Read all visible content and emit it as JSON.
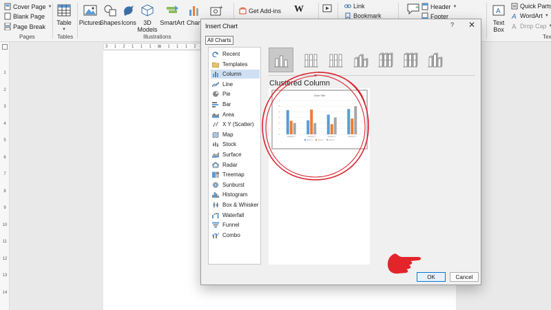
{
  "ribbon": {
    "pages_group": {
      "cover_page": "Cover Page",
      "blank_page": "Blank Page",
      "page_break": "Page Break",
      "label": "Pages"
    },
    "tables_group": {
      "table": "Table",
      "label": "Tables"
    },
    "illustrations_group": {
      "pictures": "Pictures",
      "shapes": "Shapes",
      "icons": "Icons",
      "models_3d": "3D",
      "models_3d_2": "Models",
      "smartart": "SmartArt",
      "chart": "Chart",
      "label": "Illustrations"
    },
    "addins_group": {
      "get_addins": "Get Add-ins",
      "wikipedia_glyph": "W"
    },
    "links_group": {
      "link": "Link",
      "bookmark": "Bookmark"
    },
    "header_footer_group": {
      "header": "Header",
      "footer": "Footer"
    },
    "text_group": {
      "text_box": "Text",
      "text_box_2": "Box",
      "quick_parts": "Quick Parts",
      "wordart": "WordArt",
      "drop_cap": "Drop Cap",
      "label_partial": "Tex"
    }
  },
  "ruler": {
    "horizontal_text": "3 · 1 · 2 · 1 · 1 · 1 · ⊠ · 1 · 1 · 1 · 2 · 1 · 3 · 1 · 4 · 1 · 5 · 1 · 6 · 1 · 7 · 1 · 8 · 1 · 9 · 1 · 10 · 1 · 11 · 1 · 12 · 1 · 13 · 1 · 14 · 1 · 15 · 1 · 16 · 1 · 17",
    "vertical_marks": [
      "1",
      "2",
      "3",
      "4",
      "5",
      "6",
      "7",
      "8",
      "9",
      "10",
      "11",
      "12",
      "13",
      "14"
    ]
  },
  "dialog": {
    "title": "Insert Chart",
    "help": "?",
    "close": "✕",
    "tab": "All Charts",
    "categories": [
      {
        "label": "Recent",
        "icon": "recent-icon"
      },
      {
        "label": "Templates",
        "icon": "folder-icon"
      },
      {
        "label": "Column",
        "icon": "column-chart-icon",
        "selected": true
      },
      {
        "label": "Line",
        "icon": "line-chart-icon"
      },
      {
        "label": "Pie",
        "icon": "pie-chart-icon"
      },
      {
        "label": "Bar",
        "icon": "bar-chart-icon"
      },
      {
        "label": "Area",
        "icon": "area-chart-icon"
      },
      {
        "label": "X Y (Scatter)",
        "icon": "scatter-chart-icon"
      },
      {
        "label": "Map",
        "icon": "map-chart-icon"
      },
      {
        "label": "Stock",
        "icon": "stock-chart-icon"
      },
      {
        "label": "Surface",
        "icon": "surface-chart-icon"
      },
      {
        "label": "Radar",
        "icon": "radar-chart-icon"
      },
      {
        "label": "Treemap",
        "icon": "treemap-chart-icon"
      },
      {
        "label": "Sunburst",
        "icon": "sunburst-chart-icon"
      },
      {
        "label": "Histogram",
        "icon": "histogram-chart-icon"
      },
      {
        "label": "Box & Whisker",
        "icon": "box-whisker-chart-icon"
      },
      {
        "label": "Waterfall",
        "icon": "waterfall-chart-icon"
      },
      {
        "label": "Funnel",
        "icon": "funnel-chart-icon"
      },
      {
        "label": "Combo",
        "icon": "combo-chart-icon"
      }
    ],
    "subtypes": [
      "clustered-column",
      "stacked-column",
      "100-stacked-column",
      "3d-clustered-column",
      "3d-stacked-column",
      "3d-100-stacked-column",
      "3d-column"
    ],
    "selected_subtype_title": "Clustered Column",
    "preview_title": "Chart Title",
    "ok": "OK",
    "cancel": "Cancel"
  },
  "colors": {
    "series1": "#5b9bd5",
    "series2": "#ed7d31",
    "series3": "#a5a5a5",
    "annotation": "#d9232e",
    "selection": "#cfe0f4"
  },
  "chart_data": {
    "type": "bar",
    "title": "Chart Title",
    "categories": [
      "Category 1",
      "Category 2",
      "Category 3",
      "Category 4"
    ],
    "series": [
      {
        "name": "Series 1",
        "values": [
          4.3,
          2.5,
          3.5,
          4.5
        ]
      },
      {
        "name": "Series 2",
        "values": [
          2.4,
          4.4,
          1.8,
          2.8
        ]
      },
      {
        "name": "Series 3",
        "values": [
          2,
          2,
          3,
          5
        ]
      }
    ],
    "ylim": [
      0,
      6
    ]
  }
}
